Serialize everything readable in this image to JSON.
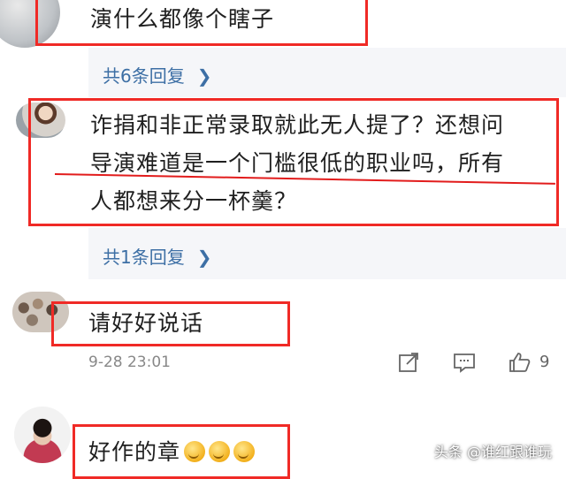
{
  "comments": [
    {
      "text": "演什么都像个瞎子",
      "reply_link": "共6条回复"
    },
    {
      "text_lines": [
        "诈捐和非正常录取就此无人提了？还想问",
        "导演难道是一个门槛很低的职业吗，所有",
        "人都想来分一杯羹？"
      ],
      "reply_link": "共1条回复"
    },
    {
      "text": "请好好说话",
      "timestamp": "9-28 23:01",
      "likes": "9"
    },
    {
      "text": "好作的章"
    }
  ],
  "icons": {
    "chevron": "chevron-right-icon",
    "share": "share-icon",
    "comment": "comment-icon",
    "like": "thumbs-up-icon"
  },
  "colors": {
    "annotation_red": "#f02a26",
    "reply_link_blue": "#3d6fa5",
    "reply_panel_bg": "#f5f6f9"
  },
  "watermark": "头条 @谁红跟谁玩"
}
